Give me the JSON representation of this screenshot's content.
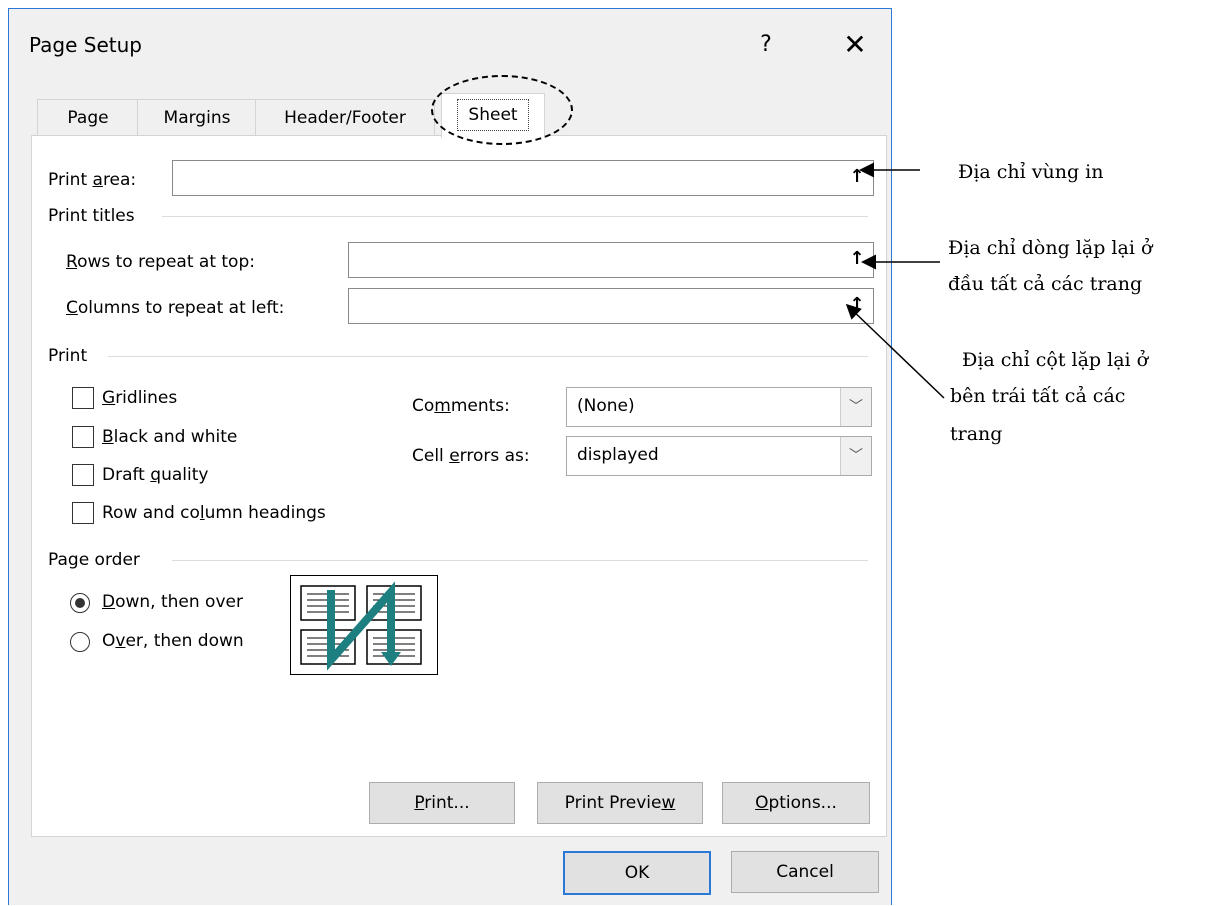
{
  "dialog": {
    "title": "Page Setup",
    "help": "?",
    "close": "✕"
  },
  "tabs": [
    {
      "label": "Page"
    },
    {
      "label": "Margins"
    },
    {
      "label": "Header/Footer"
    },
    {
      "label": "Sheet",
      "active": true
    }
  ],
  "sheet": {
    "print_area": {
      "pre": "Print ",
      "mn": "a",
      "post": "rea:",
      "value": ""
    },
    "print_titles": "Print titles",
    "rows_repeat": {
      "pre": "",
      "mn": "R",
      "post": "ows to repeat at top:",
      "value": ""
    },
    "cols_repeat": {
      "pre": "",
      "mn": "C",
      "post": "olumns to repeat at left:",
      "value": ""
    },
    "print_group": "Print",
    "checkboxes": [
      {
        "pre": "",
        "mn": "G",
        "post": "ridlines",
        "checked": false
      },
      {
        "pre": "",
        "mn": "B",
        "post": "lack and white",
        "checked": false
      },
      {
        "pre": "Draft ",
        "mn": "q",
        "post": "uality",
        "checked": false
      },
      {
        "pre": "Row and co",
        "mn": "l",
        "post": "umn headings",
        "checked": false
      }
    ],
    "comments": {
      "pre": "Co",
      "mn": "m",
      "post": "ments:",
      "value": "(None)"
    },
    "cell_errors": {
      "pre": "Cell ",
      "mn": "e",
      "post": "rrors as:",
      "value": "displayed"
    },
    "page_order": "Page order",
    "radios": [
      {
        "pre": "",
        "mn": "D",
        "post": "own, then over",
        "selected": true
      },
      {
        "pre": "O",
        "mn": "v",
        "post": "er, then down",
        "selected": false
      }
    ],
    "collapse_glyph": "↑"
  },
  "buttons": {
    "print": {
      "pre": "",
      "mn": "P",
      "post": "rint..."
    },
    "print_preview": {
      "pre": "Print Previe",
      "mn": "w",
      "post": ""
    },
    "options": {
      "pre": "",
      "mn": "O",
      "post": "ptions..."
    },
    "ok": "OK",
    "cancel": "Cancel"
  },
  "annotations": {
    "print_area": "Địa chỉ vùng in",
    "rows_line1": "Địa chỉ dòng lặp lại ở",
    "rows_line2": "đầu tất cả các trang",
    "cols_line1": "Địa chỉ cột lặp lại ở",
    "cols_line2": "bên trái tất cả các",
    "cols_line3": "trang"
  },
  "colors": {
    "accent": "#2b79d7",
    "preview_arrow": "#1e7f80"
  }
}
